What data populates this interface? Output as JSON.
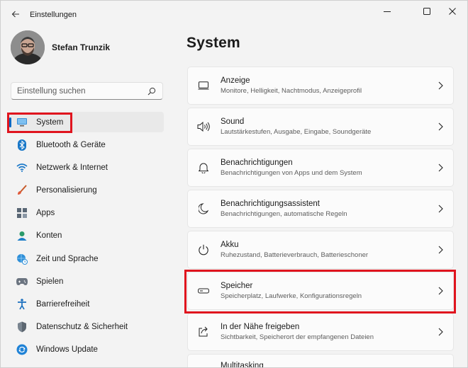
{
  "app": {
    "title": "Einstellungen"
  },
  "user": {
    "name": "Stefan Trunzik"
  },
  "search": {
    "placeholder": "Einstellung suchen"
  },
  "nav": {
    "items": [
      {
        "label": "System",
        "icon": "monitor-icon",
        "active": true
      },
      {
        "label": "Bluetooth & Geräte",
        "icon": "bluetooth-icon"
      },
      {
        "label": "Netzwerk & Internet",
        "icon": "wifi-icon"
      },
      {
        "label": "Personalisierung",
        "icon": "brush-icon"
      },
      {
        "label": "Apps",
        "icon": "apps-icon"
      },
      {
        "label": "Konten",
        "icon": "account-icon"
      },
      {
        "label": "Zeit und Sprache",
        "icon": "globe-clock-icon"
      },
      {
        "label": "Spielen",
        "icon": "gamepad-icon"
      },
      {
        "label": "Barrierefreiheit",
        "icon": "accessibility-icon"
      },
      {
        "label": "Datenschutz & Sicherheit",
        "icon": "shield-icon"
      },
      {
        "label": "Windows Update",
        "icon": "update-icon"
      }
    ]
  },
  "main": {
    "title": "System",
    "cards": [
      {
        "title": "Anzeige",
        "subtitle": "Monitore, Helligkeit, Nachtmodus, Anzeigeprofil",
        "icon": "display-icon"
      },
      {
        "title": "Sound",
        "subtitle": "Lautstärkestufen, Ausgabe, Eingabe, Soundgeräte",
        "icon": "speaker-icon"
      },
      {
        "title": "Benachrichtigungen",
        "subtitle": "Benachrichtigungen von Apps und dem System",
        "icon": "bell-icon"
      },
      {
        "title": "Benachrichtigungsassistent",
        "subtitle": "Benachrichtigungen, automatische Regeln",
        "icon": "moon-icon"
      },
      {
        "title": "Akku",
        "subtitle": "Ruhezustand, Batterieverbrauch, Batterieschoner",
        "icon": "power-icon"
      },
      {
        "title": "Speicher",
        "subtitle": "Speicherplatz, Laufwerke, Konfigurationsregeln",
        "icon": "storage-icon"
      },
      {
        "title": "In der Nähe freigeben",
        "subtitle": "Sichtbarkeit, Speicherort der empfangenen Dateien",
        "icon": "share-icon"
      },
      {
        "title": "Multitasking",
        "subtitle": "",
        "icon": "multitasking-icon"
      }
    ]
  },
  "colors": {
    "accent": "#0067c0",
    "highlight": "#e0141e"
  }
}
